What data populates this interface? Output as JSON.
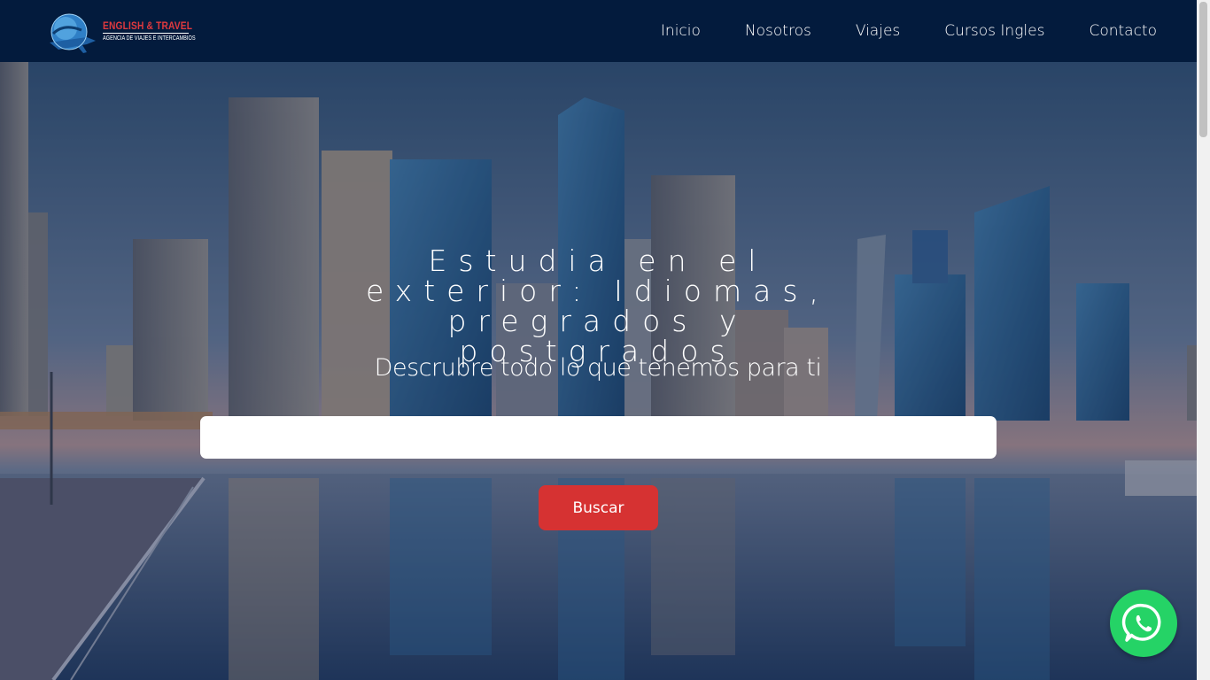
{
  "brand": {
    "name": "ENGLISH & TRAVEL",
    "tagline": "AGENCIA DE VIAJES E INTERCAMBIOS"
  },
  "nav": {
    "items": [
      "Inicio",
      "Nosotros",
      "Viajes",
      "Cursos Ingles",
      "Contacto"
    ]
  },
  "hero": {
    "title": "Estudia en el exterior: Idiomas, pregrados y postgrados",
    "subtitle": "Descrubre todo lo que tenemos para ti",
    "search_placeholder": "",
    "search_button": "Buscar"
  },
  "floating": {
    "whatsapp_icon": "whatsapp-icon"
  },
  "colors": {
    "header_bg": "#031b3d",
    "brand_red": "#e0393e",
    "button_red": "#d63232",
    "whatsapp_green": "#25d366"
  }
}
